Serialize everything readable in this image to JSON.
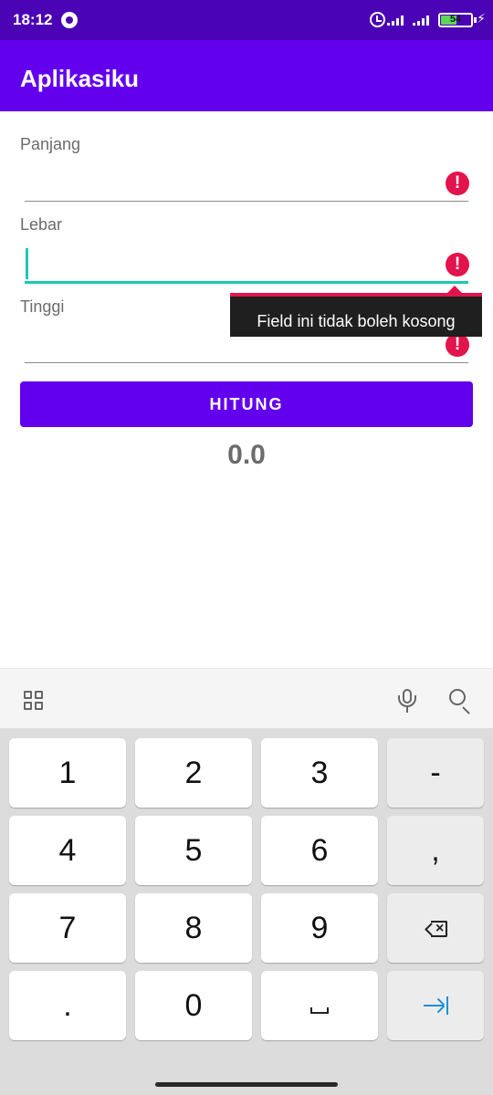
{
  "status_bar": {
    "time": "18:12",
    "battery_level": "54",
    "battery_fraction": 0.54,
    "icons": [
      "gear-icon",
      "alarm-icon",
      "signal-icon",
      "signal-icon",
      "battery-icon",
      "charging-bolt-icon"
    ]
  },
  "app_bar": {
    "title": "Aplikasiku"
  },
  "form": {
    "fields": [
      {
        "label": "Panjang",
        "value": "",
        "error": true
      },
      {
        "label": "Lebar",
        "value": "",
        "error": true,
        "focused": true
      },
      {
        "label": "Tinggi",
        "value": "",
        "error": true
      }
    ],
    "error_tooltip": "Field ini tidak boleh kosong",
    "button_label": "HITUNG",
    "result": "0.0"
  },
  "keyboard": {
    "toolbar_icons": [
      "grid-icon",
      "mic-icon",
      "search-icon"
    ],
    "rows": [
      [
        "1",
        "2",
        "3",
        "-"
      ],
      [
        "4",
        "5",
        "6",
        ","
      ],
      [
        "7",
        "8",
        "9",
        "backspace"
      ],
      [
        ".",
        "0",
        "space",
        "tab"
      ]
    ]
  },
  "colors": {
    "status_bar": "#4a04b5",
    "primary": "#6200ee",
    "accent": "#1cc7b6",
    "error": "#e3134b",
    "tooltip_bg": "#1f1f1f"
  }
}
